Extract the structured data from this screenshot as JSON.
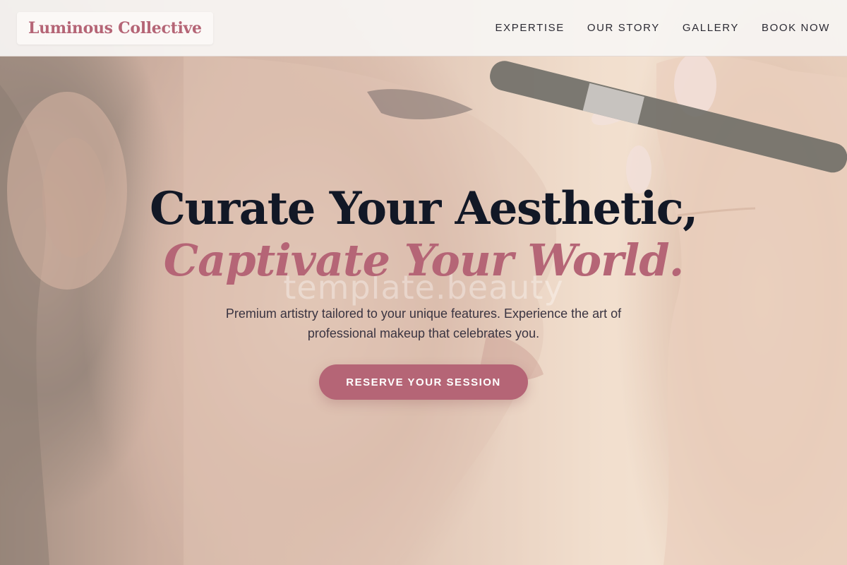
{
  "header": {
    "logo": "Luminous Collective",
    "nav": [
      "EXPERTISE",
      "OUR STORY",
      "GALLERY",
      "BOOK NOW"
    ]
  },
  "hero": {
    "headline_line1": "Curate Your Aesthetic,",
    "headline_line2": "Captivate Your World.",
    "watermark": "template.beauty",
    "subtitle": "Premium artistry tailored to your unique features. Experience the art of professional makeup that celebrates you.",
    "cta_label": "RESERVE YOUR SESSION",
    "background": "photo of woman having makeup applied with a brush"
  },
  "colors": {
    "accent": "#b56576",
    "headline_dark": "#121826",
    "nav_text": "#2b2a33"
  }
}
